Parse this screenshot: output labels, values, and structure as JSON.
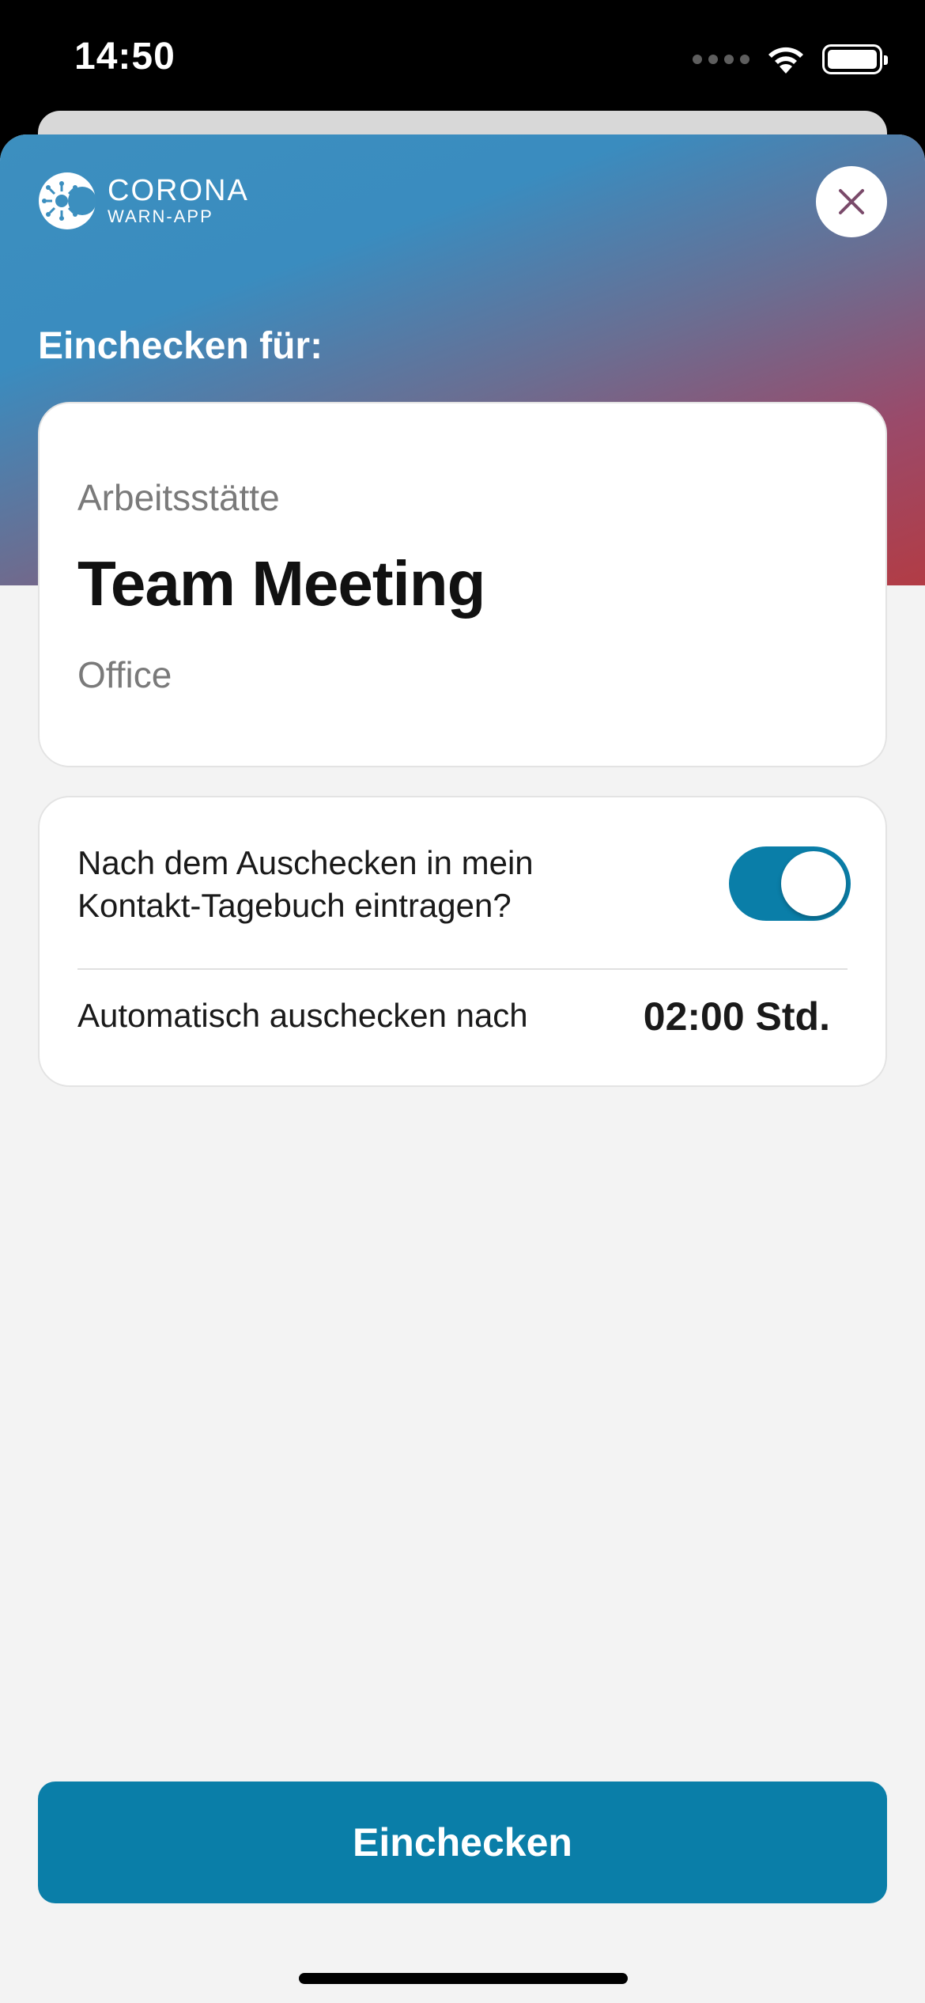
{
  "status_bar": {
    "time": "14:50"
  },
  "header": {
    "logo_line1": "CORONA",
    "logo_line2": "WARN-APP",
    "section_title": "Einchecken für:"
  },
  "location": {
    "type": "Arbeitsstätte",
    "name": "Team Meeting",
    "description": "Office"
  },
  "settings": {
    "diary_label": "Nach dem Auschecken in mein Kontakt-Tagebuch eintragen?",
    "diary_toggle_on": true,
    "auto_checkout_label": "Automatisch auschecken nach",
    "auto_checkout_value": "02:00 Std."
  },
  "actions": {
    "checkin_label": "Einchecken"
  },
  "colors": {
    "accent": "#0a7ea8",
    "gradient_start": "#3c8fbf",
    "gradient_end": "#b23c45",
    "background": "#f3f3f3"
  },
  "icons": {
    "logo": "corona-virus-logo-icon",
    "close": "close-icon",
    "wifi": "wifi-icon",
    "battery": "battery-icon",
    "signal": "signal-icon"
  }
}
